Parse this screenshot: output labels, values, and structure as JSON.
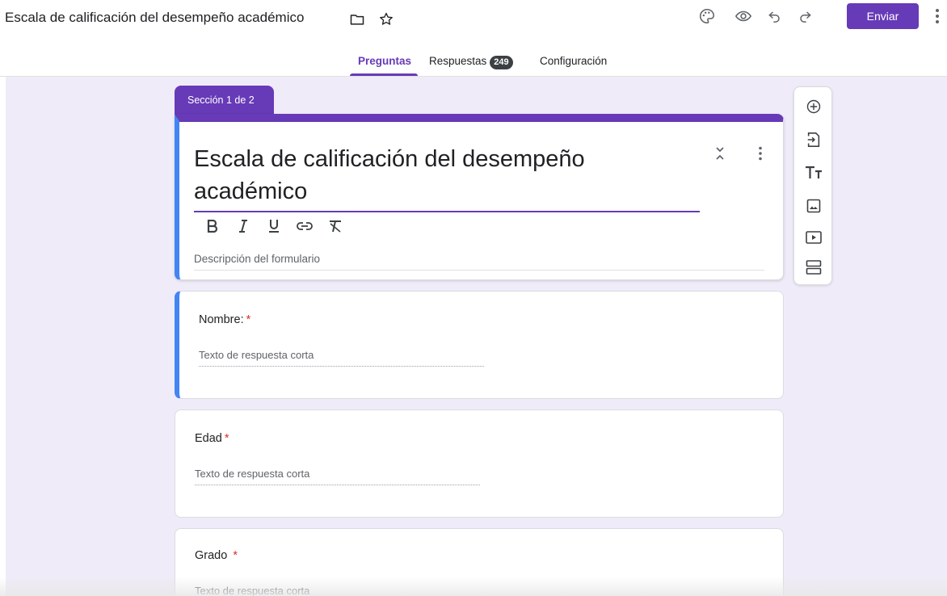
{
  "header": {
    "title": "Escala de calificación del desempeño académico",
    "send_label": "Enviar"
  },
  "tabs": [
    {
      "label": "Preguntas",
      "active": true
    },
    {
      "label": "Respuestas",
      "badge": "249"
    },
    {
      "label": "Configuración"
    }
  ],
  "section": {
    "label": "Sección 1 de 2"
  },
  "form": {
    "title": "Escala de calificación del desempeño académico",
    "description_placeholder": "Descripción del formulario"
  },
  "questions": [
    {
      "label": "Nombre:",
      "required_mark": "*",
      "answer_placeholder": "Texto de respuesta corta"
    },
    {
      "label": "Edad",
      "required_mark": "*",
      "answer_placeholder": "Texto de respuesta corta"
    },
    {
      "label": "Grado",
      "required_mark": "*",
      "answer_placeholder": "Texto de respuesta corta"
    }
  ],
  "icons": {
    "header": [
      "folder-icon",
      "star-icon",
      "palette-icon",
      "preview-icon",
      "undo-icon",
      "redo-icon",
      "more-vert-icon"
    ],
    "format": [
      "bold-icon",
      "italic-icon",
      "underline-icon",
      "link-icon",
      "clear-format-icon"
    ],
    "toolbar": [
      "add-question-icon",
      "import-questions-icon",
      "add-title-icon",
      "add-image-icon",
      "add-video-icon",
      "add-section-icon"
    ]
  },
  "colors": {
    "accent": "#673ab7",
    "focus": "#4285f4",
    "canvas": "#f0ebf8",
    "required": "#d93025"
  }
}
